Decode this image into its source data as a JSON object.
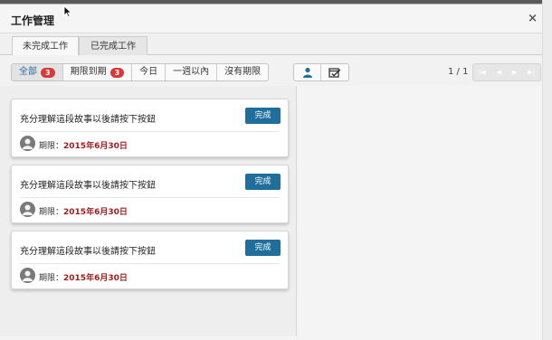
{
  "window": {
    "title": "工作管理",
    "close_symbol": "×"
  },
  "tabs": [
    {
      "label": "未完成工作",
      "active": true
    },
    {
      "label": "已完成工作",
      "active": false
    }
  ],
  "filters": [
    {
      "label": "全部",
      "badge": "3",
      "active": true
    },
    {
      "label": "期限到期",
      "badge": "3",
      "active": false
    },
    {
      "label": "今日",
      "badge": null,
      "active": false
    },
    {
      "label": "一週以內",
      "badge": null,
      "active": false
    },
    {
      "label": "沒有期限",
      "badge": null,
      "active": false
    }
  ],
  "view_icons": [
    "person-icon",
    "calendar-check-icon"
  ],
  "pagination": {
    "label": "1 / 1",
    "icons": [
      "first-page-icon",
      "prev-page-icon",
      "next-page-icon",
      "last-page-icon"
    ]
  },
  "tasks": [
    {
      "title": "充分理解這段故事以後請按下按鈕",
      "action": "完成",
      "deadline_label": "期限：",
      "deadline": "2015年6月30日"
    },
    {
      "title": "充分理解這段故事以後請按下按鈕",
      "action": "完成",
      "deadline_label": "期限：",
      "deadline": "2015年6月30日"
    },
    {
      "title": "充分理解這段故事以後請按下按鈕",
      "action": "完成",
      "deadline_label": "期限：",
      "deadline": "2015年6月30日"
    }
  ],
  "colors": {
    "accent": "#1f6e9c",
    "badge": "#d9383a",
    "deadline": "#a11d1d"
  }
}
